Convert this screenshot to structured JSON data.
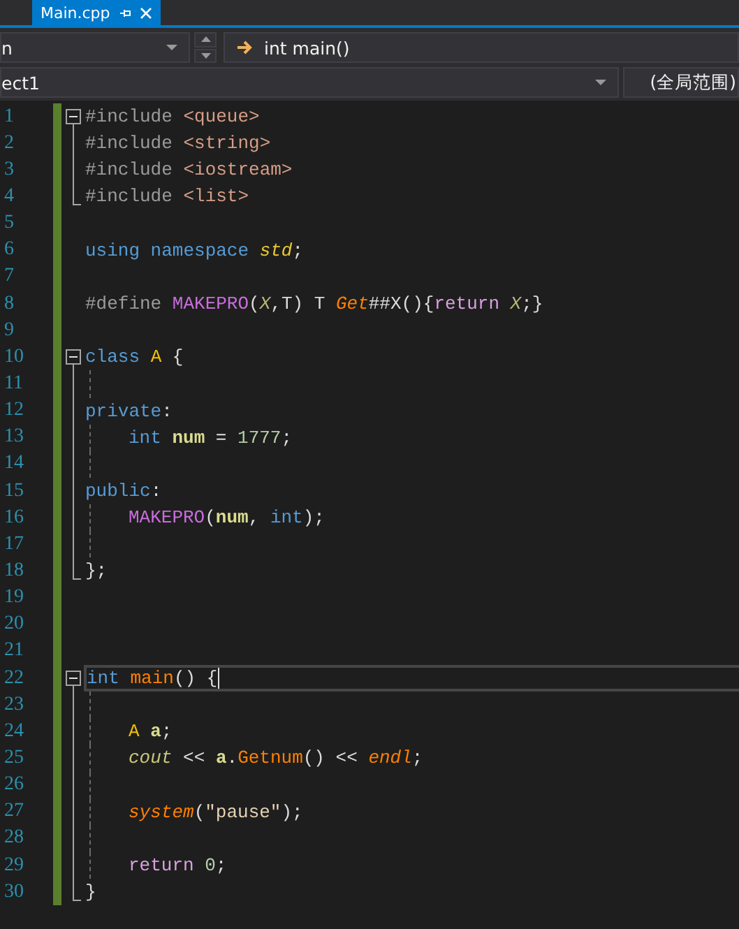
{
  "tab": {
    "label": "Main.cpp",
    "selected": true
  },
  "navigation": {
    "member_dropdown": "n",
    "function_dropdown": "int main()",
    "project_dropdown": "ect1",
    "scope_dropdown": "(全局范围)"
  },
  "lines": [
    {
      "number": "1",
      "fold_start": true,
      "changed": true,
      "tokens": [
        {
          "kind": "preproc",
          "text": "#include "
        },
        {
          "kind": "include",
          "text": "<queue>"
        }
      ]
    },
    {
      "number": "2",
      "fold_line": true,
      "changed": true,
      "tokens": [
        {
          "kind": "preproc",
          "text": "#include "
        },
        {
          "kind": "include",
          "text": "<string>"
        }
      ]
    },
    {
      "number": "3",
      "fold_line": true,
      "changed": true,
      "tokens": [
        {
          "kind": "preproc",
          "text": "#include "
        },
        {
          "kind": "include",
          "text": "<iostream>"
        }
      ]
    },
    {
      "number": "4",
      "fold_end": true,
      "changed": true,
      "tokens": [
        {
          "kind": "preproc",
          "text": "#include "
        },
        {
          "kind": "include",
          "text": "<list>"
        }
      ]
    },
    {
      "number": "5",
      "changed": true
    },
    {
      "number": "6",
      "changed": true,
      "tokens": [
        {
          "kind": "keyword",
          "text": "using namespace "
        },
        {
          "kind": "namespace",
          "text": "std"
        },
        {
          "kind": "plain",
          "text": ";"
        }
      ]
    },
    {
      "number": "7",
      "changed": true
    },
    {
      "number": "8",
      "changed": true,
      "tokens": [
        {
          "kind": "preproc",
          "text": "#define "
        },
        {
          "kind": "macro",
          "text": "MAKEPRO"
        },
        {
          "kind": "plain",
          "text": "("
        },
        {
          "kind": "param",
          "text": "X"
        },
        {
          "kind": "plain",
          "text": ",T) T "
        },
        {
          "kind": "italicfunc",
          "text": "Get"
        },
        {
          "kind": "plain",
          "text": "##X(){"
        },
        {
          "kind": "control",
          "text": "return "
        },
        {
          "kind": "param",
          "text": "X"
        },
        {
          "kind": "plain",
          "text": ";}"
        }
      ]
    },
    {
      "number": "9",
      "changed": true
    },
    {
      "number": "10",
      "fold_start": true,
      "changed": true,
      "tokens": [
        {
          "kind": "keyword",
          "text": "class "
        },
        {
          "kind": "type",
          "text": "A"
        },
        {
          "kind": "plain",
          "text": " {"
        }
      ]
    },
    {
      "number": "11",
      "fold_line": true,
      "guide": true,
      "changed": true
    },
    {
      "number": "12",
      "fold_line": true,
      "changed": true,
      "tokens": [
        {
          "kind": "keyword",
          "text": "private"
        },
        {
          "kind": "plain",
          "text": ":"
        }
      ]
    },
    {
      "number": "13",
      "fold_line": true,
      "guide": true,
      "indented": true,
      "changed": true,
      "tokens": [
        {
          "kind": "keyword",
          "text": "int "
        },
        {
          "kind": "field",
          "text": "num"
        },
        {
          "kind": "plain",
          "text": " = "
        },
        {
          "kind": "number",
          "text": "1777"
        },
        {
          "kind": "plain",
          "text": ";"
        }
      ]
    },
    {
      "number": "14",
      "fold_line": true,
      "guide": true,
      "changed": true
    },
    {
      "number": "15",
      "fold_line": true,
      "changed": true,
      "tokens": [
        {
          "kind": "keyword",
          "text": "public"
        },
        {
          "kind": "plain",
          "text": ":"
        }
      ]
    },
    {
      "number": "16",
      "fold_line": true,
      "guide": true,
      "indented": true,
      "changed": true,
      "tokens": [
        {
          "kind": "macro",
          "text": "MAKEPRO"
        },
        {
          "kind": "plain",
          "text": "("
        },
        {
          "kind": "field",
          "text": "num"
        },
        {
          "kind": "plain",
          "text": ", "
        },
        {
          "kind": "keyword",
          "text": "int"
        },
        {
          "kind": "plain",
          "text": ");"
        }
      ]
    },
    {
      "number": "17",
      "fold_line": true,
      "guide": true,
      "changed": true
    },
    {
      "number": "18",
      "fold_end": true,
      "changed": true,
      "tokens": [
        {
          "kind": "plain",
          "text": "};"
        }
      ]
    },
    {
      "number": "19",
      "changed": true
    },
    {
      "number": "20",
      "changed": true
    },
    {
      "number": "21",
      "changed": true
    },
    {
      "number": "22",
      "fold_start": true,
      "current": true,
      "changed": true,
      "tokens": [
        {
          "kind": "keyword",
          "text": "int "
        },
        {
          "kind": "function",
          "text": "main"
        },
        {
          "kind": "plain",
          "text": "() {"
        }
      ]
    },
    {
      "number": "23",
      "fold_line": true,
      "guide": true,
      "changed": true
    },
    {
      "number": "24",
      "fold_line": true,
      "guide": true,
      "indented": true,
      "changed": true,
      "tokens": [
        {
          "kind": "type",
          "text": "A "
        },
        {
          "kind": "local",
          "text": "a"
        },
        {
          "kind": "plain",
          "text": ";"
        }
      ]
    },
    {
      "number": "25",
      "fold_line": true,
      "guide": true,
      "indented": true,
      "changed": true,
      "tokens": [
        {
          "kind": "global",
          "text": "cout"
        },
        {
          "kind": "plain",
          "text": " << "
        },
        {
          "kind": "local",
          "text": "a"
        },
        {
          "kind": "plain",
          "text": "."
        },
        {
          "kind": "function",
          "text": "Getnum"
        },
        {
          "kind": "plain",
          "text": "() << "
        },
        {
          "kind": "italicfunc",
          "text": "endl"
        },
        {
          "kind": "plain",
          "text": ";"
        }
      ]
    },
    {
      "number": "26",
      "fold_line": true,
      "guide": true,
      "changed": true
    },
    {
      "number": "27",
      "fold_line": true,
      "guide": true,
      "indented": true,
      "changed": true,
      "tokens": [
        {
          "kind": "italicfunc",
          "text": "system"
        },
        {
          "kind": "plain",
          "text": "("
        },
        {
          "kind": "string",
          "text": "\"pause\""
        },
        {
          "kind": "plain",
          "text": ");"
        }
      ]
    },
    {
      "number": "28",
      "fold_line": true,
      "guide": true,
      "changed": true
    },
    {
      "number": "29",
      "fold_line": true,
      "guide": true,
      "indented": true,
      "changed": true,
      "tokens": [
        {
          "kind": "control",
          "text": "return "
        },
        {
          "kind": "number",
          "text": "0"
        },
        {
          "kind": "plain",
          "text": ";"
        }
      ]
    },
    {
      "number": "30",
      "fold_end": true,
      "changed": true,
      "tokens": [
        {
          "kind": "plain",
          "text": "}"
        }
      ]
    }
  ]
}
